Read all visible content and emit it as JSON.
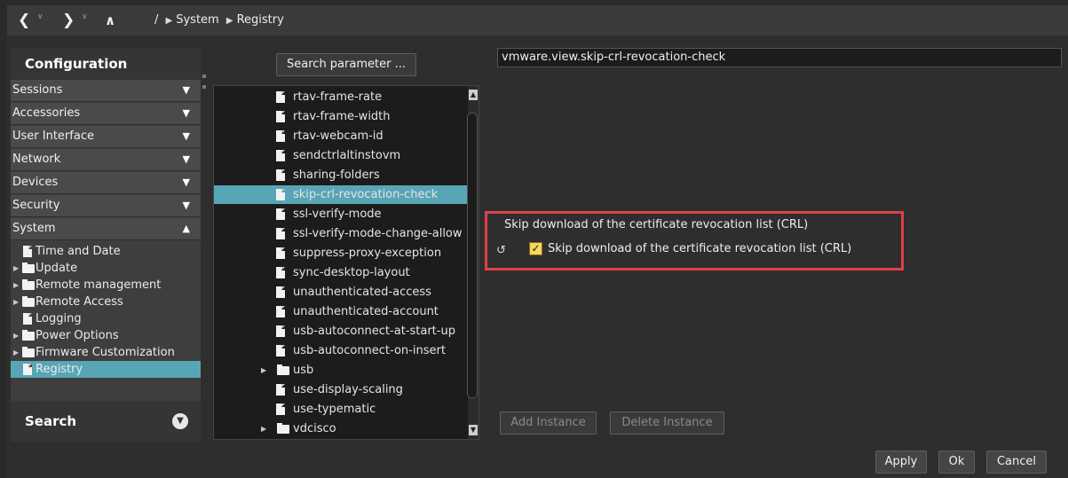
{
  "nav": {
    "back_icon": "chevron-left-icon",
    "forward_icon": "chevron-right-icon",
    "up_icon": "chevron-up-icon",
    "breadcrumb_root": "/",
    "breadcrumb": [
      "System",
      "Registry"
    ]
  },
  "sidebar": {
    "title": "Configuration",
    "categories": [
      {
        "label": "Sessions",
        "expanded": false
      },
      {
        "label": "Accessories",
        "expanded": false
      },
      {
        "label": "User Interface",
        "expanded": false
      },
      {
        "label": "Network",
        "expanded": false
      },
      {
        "label": "Devices",
        "expanded": false
      },
      {
        "label": "Security",
        "expanded": false
      },
      {
        "label": "System",
        "expanded": true
      }
    ],
    "system_items": [
      {
        "label": "Time and Date",
        "type": "file"
      },
      {
        "label": "Update",
        "type": "folder"
      },
      {
        "label": "Remote management",
        "type": "folder"
      },
      {
        "label": "Remote Access",
        "type": "folder"
      },
      {
        "label": "Logging",
        "type": "file"
      },
      {
        "label": "Power Options",
        "type": "folder"
      },
      {
        "label": "Firmware Customization",
        "type": "folder"
      },
      {
        "label": "Registry",
        "type": "file",
        "selected": true
      }
    ],
    "search_label": "Search"
  },
  "params": {
    "search_button": "Search parameter ...",
    "items": [
      {
        "label": "rtav-frame-rate",
        "type": "file"
      },
      {
        "label": "rtav-frame-width",
        "type": "file"
      },
      {
        "label": "rtav-webcam-id",
        "type": "file"
      },
      {
        "label": "sendctrlaltinstovm",
        "type": "file"
      },
      {
        "label": "sharing-folders",
        "type": "file"
      },
      {
        "label": "skip-crl-revocation-check",
        "type": "file",
        "selected": true
      },
      {
        "label": "ssl-verify-mode",
        "type": "file"
      },
      {
        "label": "ssl-verify-mode-change-allow",
        "type": "file"
      },
      {
        "label": "suppress-proxy-exception",
        "type": "file"
      },
      {
        "label": "sync-desktop-layout",
        "type": "file"
      },
      {
        "label": "unauthenticated-access",
        "type": "file"
      },
      {
        "label": "unauthenticated-account",
        "type": "file"
      },
      {
        "label": "usb-autoconnect-at-start-up",
        "type": "file"
      },
      {
        "label": "usb-autoconnect-on-insert",
        "type": "file"
      },
      {
        "label": "usb",
        "type": "folder"
      },
      {
        "label": "use-display-scaling",
        "type": "file"
      },
      {
        "label": "use-typematic",
        "type": "file"
      },
      {
        "label": "vdcisco",
        "type": "folder"
      }
    ]
  },
  "detail": {
    "param_path": "vmware.view.skip-crl-revocation-check",
    "description": "Skip download of the certificate revocation list (CRL)",
    "checkbox_label": "Skip download of the certificate revocation list (CRL)",
    "checkbox_checked": true,
    "checkbox_mark": "✓",
    "reset_icon": "reset-icon",
    "add_instance": "Add Instance",
    "delete_instance": "Delete Instance"
  },
  "footer": {
    "apply": "Apply",
    "ok": "Ok",
    "cancel": "Cancel"
  },
  "colors": {
    "selection": "#58a6b5",
    "highlight_box": "#e04048",
    "checkbox": "#f5d85a"
  }
}
